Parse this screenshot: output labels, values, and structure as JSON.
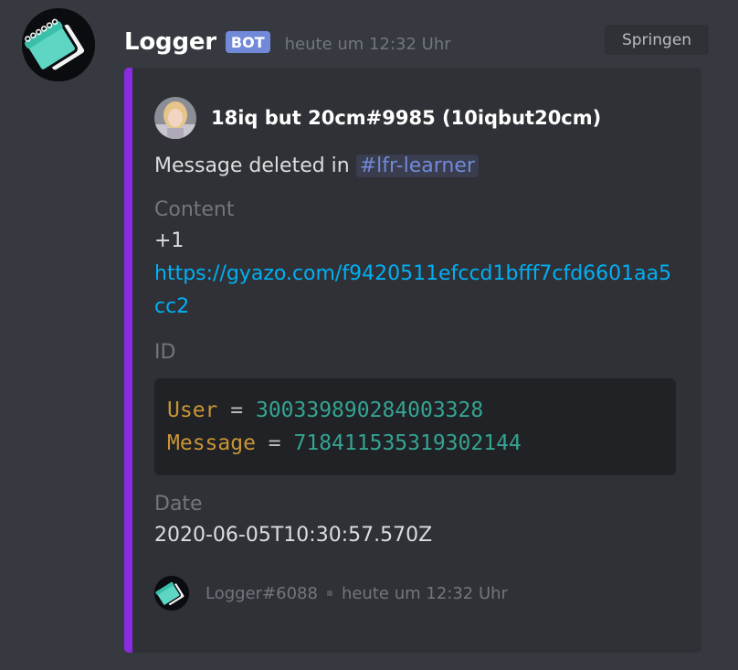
{
  "message": {
    "author": {
      "name": "Logger",
      "bot_tag": "BOT",
      "avatar_icon": "notepad-icon"
    },
    "timestamp": "heute um 12:32 Uhr",
    "jump_button": "Springen"
  },
  "embed": {
    "color": "#8a2be2",
    "author": {
      "name": "18iq but 20cm#9985 (10iqbut20cm)",
      "avatar_icon": "user-avatar-icon"
    },
    "description_prefix": "Message deleted in ",
    "channel_mention": "#lfr-learner",
    "fields": {
      "content": {
        "name": "Content",
        "text": "+1",
        "link": "https://gyazo.com/f9420511efccd1bfff7cfd6601aa5cc2"
      },
      "id": {
        "name": "ID",
        "user_key": "User",
        "user_value": "300339890284003328",
        "message_key": "Message",
        "message_value": "718411535319302144",
        "equals": "="
      },
      "date": {
        "name": "Date",
        "value": "2020-06-05T10:30:57.570Z"
      }
    },
    "footer": {
      "text": "Logger#6088",
      "timestamp": "heute um 12:32 Uhr",
      "icon": "notepad-icon"
    }
  }
}
